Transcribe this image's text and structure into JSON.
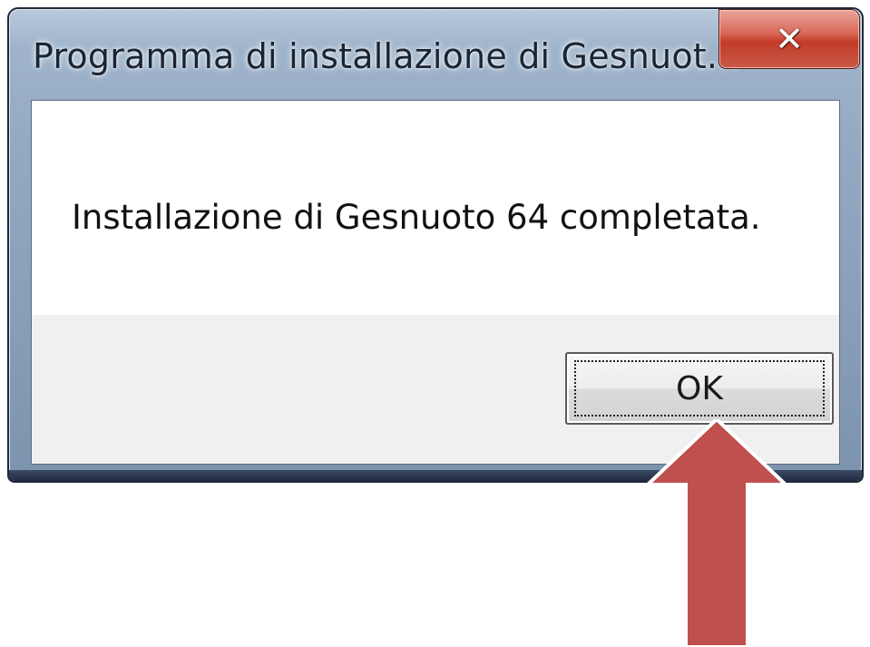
{
  "dialog": {
    "title": "Programma di installazione di Gesnuot...",
    "message": "Installazione di Gesnuoto 64 completata.",
    "ok_label": "OK",
    "close_symbol": "✕"
  },
  "annotation": {
    "arrow_color": "#c0504d",
    "arrow_target": "ok-button"
  },
  "icons": {
    "close": "close-icon",
    "arrow": "red-arrow-icon"
  }
}
